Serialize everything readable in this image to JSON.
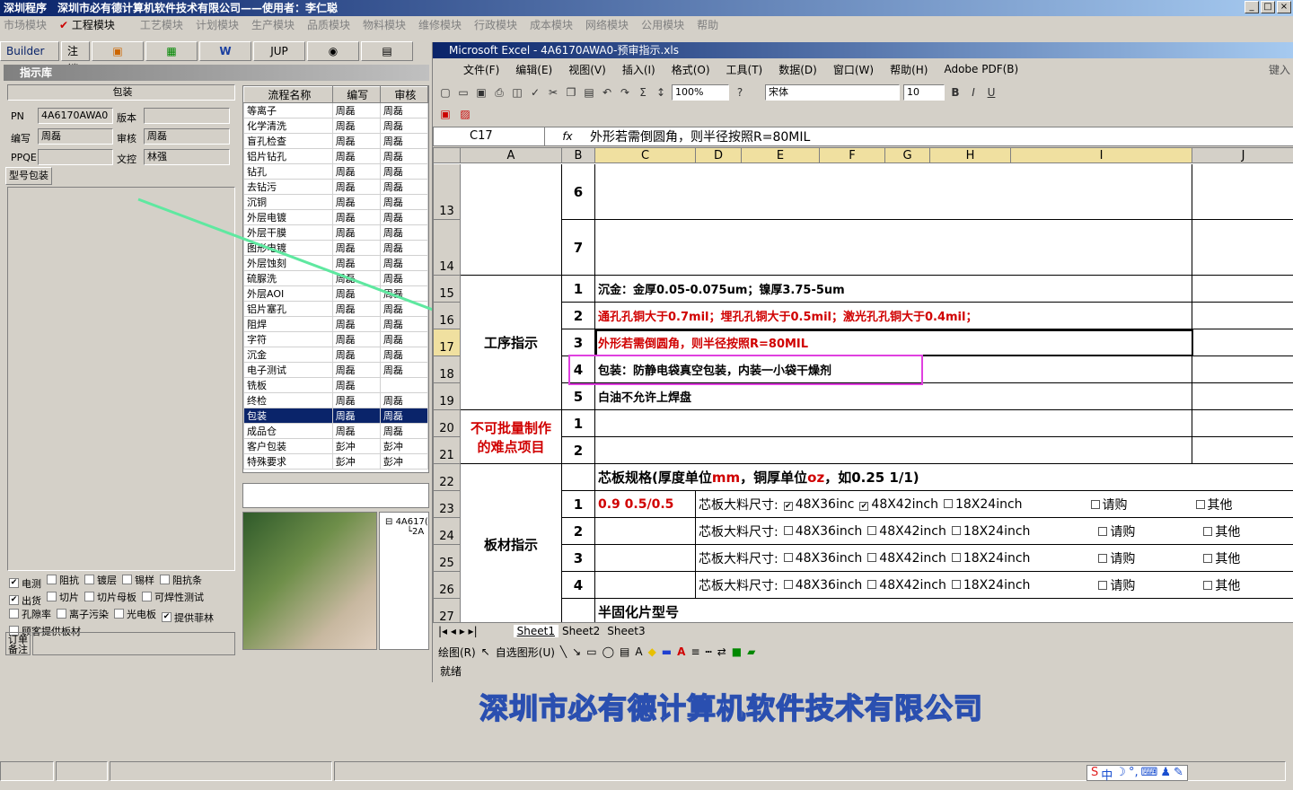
{
  "app": {
    "title": "深圳程序　深圳市必有德计算机软件技术有限公司——使用者：李仁聪",
    "win_buttons": [
      "_",
      "□",
      "×"
    ]
  },
  "menu": [
    "市场模块",
    "工程模块",
    "工艺模块",
    "计划模块",
    "生产模块",
    "品质模块",
    "物料模块",
    "维修模块",
    "行政模块",
    "成本模块",
    "网络模块",
    "公用模块",
    "帮助"
  ],
  "toolbar_tabs": [
    "Builder",
    "注销",
    "",
    "",
    "W",
    "JUP",
    "",
    ""
  ],
  "panel": {
    "title": "指示库",
    "header": "包装",
    "pn_label": "PN",
    "pn_value": "4A6170AWA0",
    "version_label": "版本",
    "version_value": "",
    "author_label": "编写",
    "author_value": "周磊",
    "review_label": "审核",
    "review_value": "周磊",
    "ppqe_label": "PPQE",
    "ppqe_value": "",
    "doc_control_label": "文控",
    "doc_control_value": "林强",
    "tab": "型号包装",
    "bottom_tab": "订单备注"
  },
  "grid": {
    "headers": [
      "流程名称",
      "编写",
      "审核"
    ],
    "rows": [
      [
        "等离子",
        "周磊",
        "周磊"
      ],
      [
        "化学清洗",
        "周磊",
        "周磊"
      ],
      [
        "盲孔检查",
        "周磊",
        "周磊"
      ],
      [
        "铝片钻孔",
        "周磊",
        "周磊"
      ],
      [
        "钻孔",
        "周磊",
        "周磊"
      ],
      [
        "去钻污",
        "周磊",
        "周磊"
      ],
      [
        "沉铜",
        "周磊",
        "周磊"
      ],
      [
        "外层电镀",
        "周磊",
        "周磊"
      ],
      [
        "外层干膜",
        "周磊",
        "周磊"
      ],
      [
        "图形电镀",
        "周磊",
        "周磊"
      ],
      [
        "外层蚀刻",
        "周磊",
        "周磊"
      ],
      [
        "硫脲洗",
        "周磊",
        "周磊"
      ],
      [
        "外层AOI",
        "周磊",
        "周磊"
      ],
      [
        "铝片塞孔",
        "周磊",
        "周磊"
      ],
      [
        "阻焊",
        "周磊",
        "周磊"
      ],
      [
        "字符",
        "周磊",
        "周磊"
      ],
      [
        "沉金",
        "周磊",
        "周磊"
      ],
      [
        "电子测试",
        "周磊",
        "周磊"
      ],
      [
        "铣板",
        "周磊",
        ""
      ],
      [
        "终检",
        "周磊",
        "周磊"
      ],
      [
        "包装",
        "周磊",
        "周磊"
      ],
      [
        "成品仓",
        "周磊",
        "周磊"
      ],
      [
        "客户包装",
        "彭冲",
        "彭冲"
      ],
      [
        "特殊要求",
        "彭冲",
        "彭冲"
      ]
    ],
    "selected": 20
  },
  "tree": {
    "node1": "4A617(",
    "node2": "2A"
  },
  "checks": [
    {
      "label": "电测",
      "checked": true
    },
    {
      "label": "阻抗",
      "checked": false
    },
    {
      "label": "镀层",
      "checked": false
    },
    {
      "label": "锡样",
      "checked": false
    },
    {
      "label": "阻抗条",
      "checked": false
    },
    {
      "label": "出货",
      "checked": true
    },
    {
      "label": "切片",
      "checked": false
    },
    {
      "label": "切片母板",
      "checked": false
    },
    {
      "label": "可焊性测试",
      "checked": false
    },
    {
      "label": "孔隙率",
      "checked": false
    },
    {
      "label": "离子污染",
      "checked": false
    },
    {
      "label": "光电板",
      "checked": false
    },
    {
      "label": "提供菲林",
      "checked": true
    },
    {
      "label": "顾客提供板材",
      "checked": false
    }
  ],
  "excel": {
    "title": "Microsoft Excel - 4A6170AWA0-预审指示.xls",
    "menu": [
      "文件(F)",
      "编辑(E)",
      "视图(V)",
      "插入(I)",
      "格式(O)",
      "工具(T)",
      "数据(D)",
      "窗口(W)",
      "帮助(H)",
      "Adobe PDF(B)"
    ],
    "menu_right": "键入",
    "zoom": "100%",
    "font": "宋体",
    "size": "10",
    "namebox": "C17",
    "formula": "外形若需倒圆角，则半径按照R=80MIL",
    "cols": [
      "A",
      "B",
      "C",
      "D",
      "E",
      "F",
      "G",
      "H",
      "I",
      "J"
    ],
    "rows": [
      "13",
      "14",
      "15",
      "16",
      "17",
      "18",
      "19",
      "20",
      "21",
      "22",
      "23",
      "24",
      "25",
      "26",
      "27"
    ],
    "section1": "工序指示",
    "section2": "不可批量制作的难点项目",
    "section3": "板材指示",
    "nums": [
      "6",
      "7",
      "1",
      "2",
      "3",
      "4",
      "5",
      "1",
      "2",
      "1",
      "2",
      "3",
      "4"
    ],
    "line15": "沉金：金厚0.05-0.075um；镍厚3.75-5um",
    "line16": "通孔孔铜大于0.7mil；埋孔孔铜大于0.5mil；激光孔孔铜大于0.4mil；",
    "line17": "外形若需倒圆角，则半径按照R=80MIL",
    "line18": "包装：防静电袋真空包装，内装一小袋干燥剂",
    "line19": "白油不允许上焊盘",
    "core_hdr_a": "芯板规格(厚度单位",
    "core_hdr_mm": "mm",
    "core_hdr_b": "，铜厚单位",
    "core_hdr_oz": "oz",
    "core_hdr_c": "，如0.25 1/1)",
    "core_spec": "0.9 0.5/0.5",
    "core_label": "芯板大料尺寸:",
    "opt1": "48X36inc",
    "opt1b": "48X36inch",
    "opt2": "48X42inch",
    "opt3": "18X24inch",
    "opt4": "请购",
    "opt5": "其他",
    "prepreg": "半固化片型号",
    "sheets": [
      "Sheet1",
      "Sheet2",
      "Sheet3"
    ],
    "draw": "绘图(R)",
    "autoshape": "自选图形(U)",
    "status": "就绪"
  },
  "banner": "深圳市必有德计算机软件技术有限公司",
  "ime": "中"
}
